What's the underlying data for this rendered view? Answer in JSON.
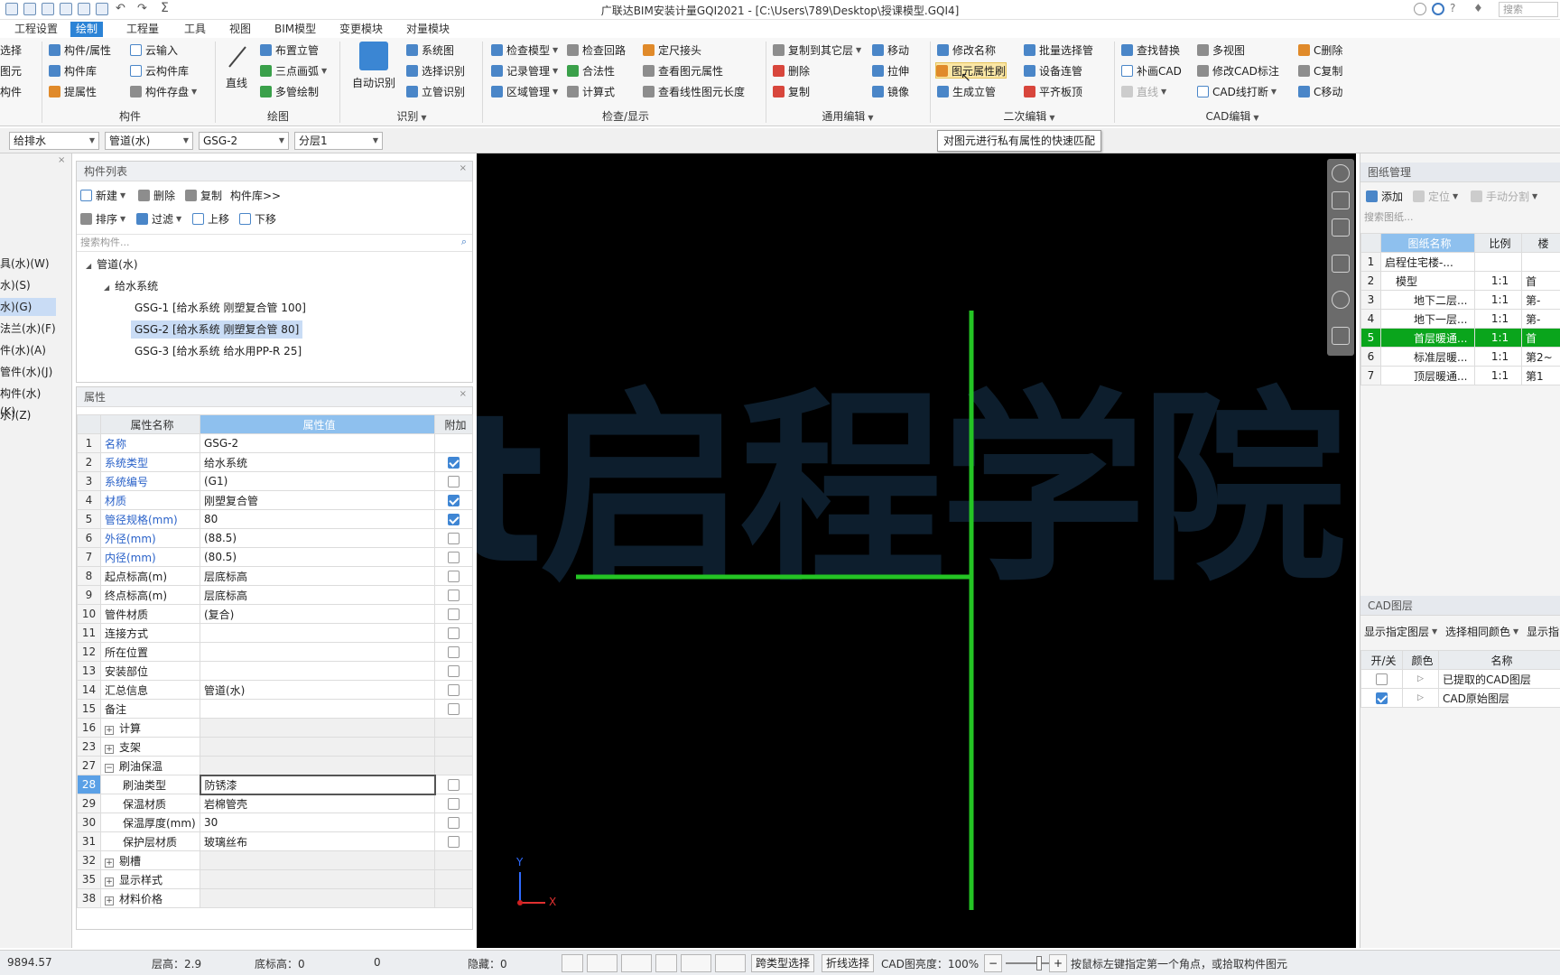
{
  "window": {
    "title": "广联达BIM安装计量GQI2021 - [C:\\Users\\789\\Desktop\\授课模型.GQI4]",
    "search_placeholder": "搜索"
  },
  "menu": [
    "工程设置",
    "绘制",
    "工程量",
    "工具",
    "视图",
    "BIM模型",
    "变更模块",
    "对量模块"
  ],
  "ribbon": {
    "g1": {
      "items": [
        "选择",
        "图元",
        "构件"
      ]
    },
    "g2": {
      "label": "构件",
      "items": [
        "构件/属性",
        "构件库",
        "提属性",
        "云输入",
        "云构件库",
        "构件存盘"
      ]
    },
    "g3": {
      "label": "绘图",
      "line": "直线",
      "items": [
        "布置立管",
        "三点画弧",
        "多管绘制"
      ]
    },
    "g4": {
      "label": "识别",
      "auto": "自动识别",
      "items": [
        "系统图",
        "选择识别",
        "立管识别"
      ]
    },
    "g5": {
      "label": "检查/显示",
      "items": [
        "检查模型",
        "记录管理",
        "区域管理",
        "检查回路",
        "合法性",
        "计算式",
        "定尺接头",
        "查看图元属性",
        "查看线性图元长度"
      ]
    },
    "g6": {
      "label": "通用编辑",
      "items": [
        "复制到其它层",
        "删除",
        "复制",
        "移动",
        "拉伸",
        "镜像"
      ]
    },
    "g7": {
      "label": "二次编辑",
      "items": [
        "修改名称",
        "图元属性刷",
        "生成立管",
        "批量选择管",
        "设备连管",
        "平齐板顶"
      ]
    },
    "g8": {
      "label": "CAD编辑",
      "items": [
        "查找替换",
        "补画CAD",
        "直线",
        "多视图",
        "修改CAD标注",
        "CAD线打断",
        "C删除",
        "C复制",
        "C移动"
      ]
    }
  },
  "tooltip": "对图元进行私有属性的快速匹配",
  "selectors": [
    "给排水",
    "管道(水)",
    "GSG-2",
    "分层1"
  ],
  "left_edge": [
    "选择",
    "具(水)(W)",
    "水)(S)",
    "水)(G)",
    "法兰(水)(F)",
    "件(水)(A)",
    "管件(水)(J)",
    "构件(水)(K)",
    "水)(Z)"
  ],
  "component_list": {
    "header": "构件列表",
    "toolbar": [
      "新建",
      "删除",
      "复制",
      "构件库>>",
      "排序",
      "过滤",
      "上移",
      "下移"
    ],
    "search_placeholder": "搜索构件...",
    "tree": {
      "root": "管道(水)",
      "group": "给水系统",
      "items": [
        "GSG-1 [给水系统 刚塑复合管 100]",
        "GSG-2 [给水系统 刚塑复合管 80]",
        "GSG-3 [给水系统 给水用PP-R 25]"
      ]
    }
  },
  "properties": {
    "header": "属性",
    "columns": [
      "属性名称",
      "属性值",
      "附加"
    ],
    "rows": [
      {
        "n": "1",
        "name": "名称",
        "val": "GSG-2",
        "blue": true,
        "check": null
      },
      {
        "n": "2",
        "name": "系统类型",
        "val": "给水系统",
        "blue": true,
        "check": true
      },
      {
        "n": "3",
        "name": "系统编号",
        "val": "(G1)",
        "blue": true,
        "check": false
      },
      {
        "n": "4",
        "name": "材质",
        "val": "刚塑复合管",
        "blue": true,
        "check": true
      },
      {
        "n": "5",
        "name": "管径规格(mm)",
        "val": "80",
        "blue": true,
        "check": true
      },
      {
        "n": "6",
        "name": "外径(mm)",
        "val": "(88.5)",
        "blue": true,
        "check": false
      },
      {
        "n": "7",
        "name": "内径(mm)",
        "val": "(80.5)",
        "blue": true,
        "check": false
      },
      {
        "n": "8",
        "name": "起点标高(m)",
        "val": "层底标高",
        "blue": false,
        "check": false
      },
      {
        "n": "9",
        "name": "终点标高(m)",
        "val": "层底标高",
        "blue": false,
        "check": false
      },
      {
        "n": "10",
        "name": "管件材质",
        "val": "(复合)",
        "blue": false,
        "check": false
      },
      {
        "n": "11",
        "name": "连接方式",
        "val": "",
        "blue": false,
        "check": false
      },
      {
        "n": "12",
        "name": "所在位置",
        "val": "",
        "blue": false,
        "check": false
      },
      {
        "n": "13",
        "name": "安装部位",
        "val": "",
        "blue": false,
        "check": false
      },
      {
        "n": "14",
        "name": "汇总信息",
        "val": "管道(水)",
        "blue": false,
        "check": false
      },
      {
        "n": "15",
        "name": "备注",
        "val": "",
        "blue": false,
        "check": false
      },
      {
        "n": "16",
        "name": "计算",
        "val": "",
        "group": true
      },
      {
        "n": "23",
        "name": "支架",
        "val": "",
        "group": true
      },
      {
        "n": "27",
        "name": "刷油保温",
        "val": "",
        "group": true,
        "open": true
      },
      {
        "n": "28",
        "name": "刷油类型",
        "val": "防锈漆",
        "indent": true,
        "check": false,
        "current": true
      },
      {
        "n": "29",
        "name": "保温材质",
        "val": "岩棉管壳",
        "indent": true,
        "check": false
      },
      {
        "n": "30",
        "name": "保温厚度(mm)",
        "val": "30",
        "indent": true,
        "check": false
      },
      {
        "n": "31",
        "name": "保护层材质",
        "val": "玻璃丝布",
        "indent": true,
        "check": false
      },
      {
        "n": "32",
        "name": "剔槽",
        "val": "",
        "group": true
      },
      {
        "n": "35",
        "name": "显示样式",
        "val": "",
        "group": true
      },
      {
        "n": "38",
        "name": "材料价格",
        "val": "",
        "group": true
      }
    ]
  },
  "canvas": {
    "watermark": "rt启程学院",
    "axis_y": "Y",
    "axis_x": "X"
  },
  "drawings": {
    "header": "图纸管理",
    "toolbar": [
      "添加",
      "定位",
      "手动分割"
    ],
    "search_placeholder": "搜索图纸...",
    "columns": [
      "图纸名称",
      "比例",
      "楼"
    ],
    "rows": [
      {
        "n": "1",
        "name": "启程住宅楼-...",
        "scale": "",
        "floor": ""
      },
      {
        "n": "2",
        "name": "模型",
        "scale": "1:1",
        "floor": "首"
      },
      {
        "n": "3",
        "name": "地下二层...",
        "scale": "1:1",
        "floor": "第-"
      },
      {
        "n": "4",
        "name": "地下一层...",
        "scale": "1:1",
        "floor": "第-"
      },
      {
        "n": "5",
        "name": "首层暖通...",
        "scale": "1:1",
        "floor": "首",
        "hi": true
      },
      {
        "n": "6",
        "name": "标准层暖...",
        "scale": "1:1",
        "floor": "第2~"
      },
      {
        "n": "7",
        "name": "顶层暖通...",
        "scale": "1:1",
        "floor": "第1"
      }
    ]
  },
  "cad_layers": {
    "header": "CAD图层",
    "toolbar": [
      "显示指定图层",
      "选择相同颜色",
      "显示指"
    ],
    "columns": [
      "开/关",
      "颜色",
      "名称"
    ],
    "rows": [
      {
        "name": "已提取的CAD图层",
        "on": false
      },
      {
        "name": "CAD原始图层",
        "on": true
      }
    ]
  },
  "status": {
    "coord": "9894.57",
    "floor_height": "层高：2.9",
    "floor_base": "底标高：0",
    "zero": "0",
    "hidden": "隐藏：0",
    "btn_cross": "跨类型选择",
    "btn_poly": "折线选择",
    "brightness": "CAD图亮度：100%",
    "hint": "按鼠标左键指定第一个角点，或拾取构件图元"
  }
}
